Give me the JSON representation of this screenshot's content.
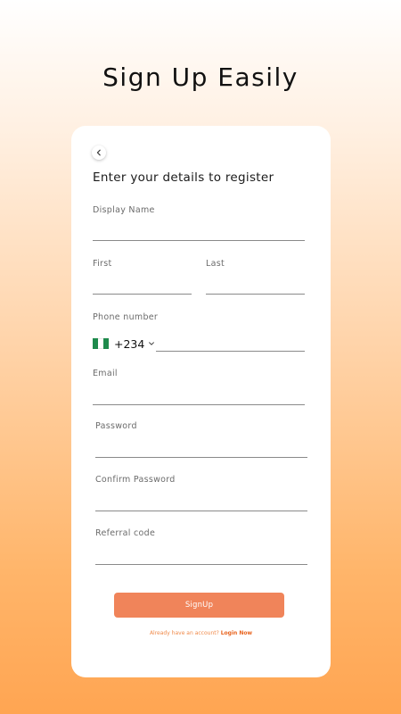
{
  "header": {
    "title": "Sign Up Easily"
  },
  "form": {
    "subtitle": "Enter your details to register",
    "display_name": {
      "label": "Display Name",
      "value": ""
    },
    "first": {
      "label": "First",
      "value": ""
    },
    "last": {
      "label": "Last",
      "value": ""
    },
    "phone": {
      "label": "Phone number",
      "country_code": "+234",
      "country_flag": "nigeria-flag-icon",
      "value": ""
    },
    "email": {
      "label": "Email",
      "value": ""
    },
    "password": {
      "label": "Password",
      "value": ""
    },
    "confirm_password": {
      "label": "Confirm Password",
      "value": ""
    },
    "referral": {
      "label": "Referral code",
      "value": ""
    },
    "submit_label": "SignUp",
    "footer_prompt": "Already have an account?",
    "footer_link": "Login Now"
  },
  "colors": {
    "accent": "#f0845a",
    "link": "#e8621c",
    "gradient_top": "#ffffff",
    "gradient_bottom": "#ffa552",
    "flag_green": "#1e8a4c"
  }
}
